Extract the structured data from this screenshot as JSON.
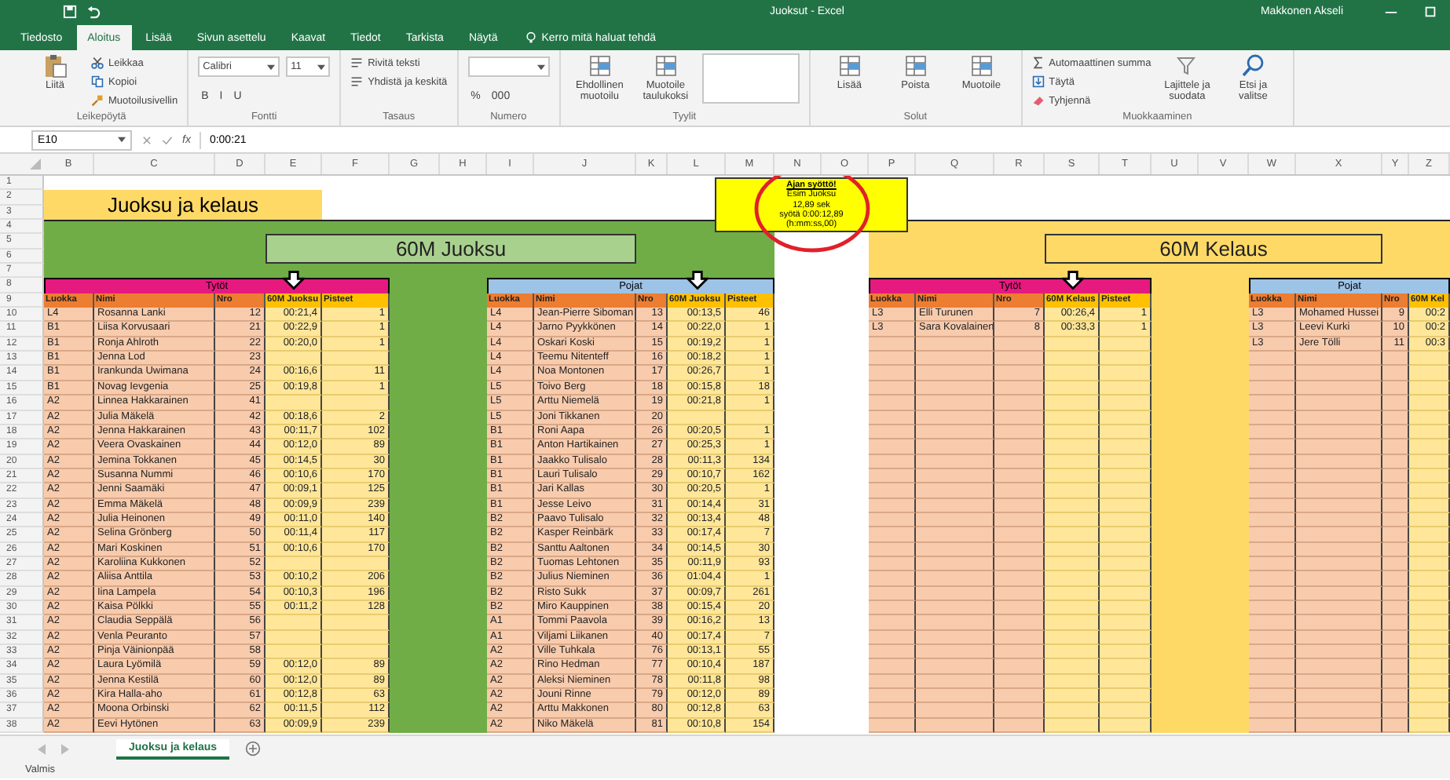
{
  "window": {
    "title": "Juoksut - Excel",
    "user": "Makkonen Akseli"
  },
  "tabs": [
    {
      "label": "Tiedosto",
      "selected": false
    },
    {
      "label": "Aloitus",
      "selected": true
    },
    {
      "label": "Lisää",
      "selected": false
    },
    {
      "label": "Sivun asettelu",
      "selected": false
    },
    {
      "label": "Kaavat",
      "selected": false
    },
    {
      "label": "Tiedot",
      "selected": false
    },
    {
      "label": "Tarkista",
      "selected": false
    },
    {
      "label": "Näytä",
      "selected": false
    }
  ],
  "tell_me": {
    "placeholder": "Kerro mitä haluat tehdä"
  },
  "ribbon": [
    {
      "label": "Leikepöytä",
      "items": [
        {
          "kind": "paste",
          "label": "Liitä"
        },
        {
          "kind": "cut",
          "label": "Leikkaa"
        },
        {
          "kind": "copy",
          "label": "Kopioi"
        },
        {
          "kind": "brush",
          "label": "Muotoilusivellin"
        }
      ]
    },
    {
      "label": "Fontti",
      "items": [
        {
          "kind": "dropdown",
          "label": "Calibri"
        },
        {
          "kind": "glyphs",
          "labels": [
            "B",
            "I",
            "U"
          ]
        },
        {
          "kind": "dropdown",
          "label": "11"
        }
      ]
    },
    {
      "label": "Tasaus",
      "items": [
        {
          "kind": "wrap",
          "label": "Rivitä teksti"
        },
        {
          "kind": "merge",
          "label": "Yhdistä ja keskitä"
        }
      ]
    },
    {
      "label": "Numero",
      "items": [
        {
          "kind": "dropdown"
        },
        {
          "kind": "glyphs",
          "labels": [
            "%",
            "000"
          ]
        }
      ]
    },
    {
      "label": "Tyylit",
      "items": [
        {
          "kind": "table",
          "label": "Ehdollinen muotoilu"
        },
        {
          "kind": "table",
          "label": "Muotoile taulukoksi"
        },
        {
          "kind": "gallery"
        }
      ]
    },
    {
      "label": "Solut",
      "items": [
        {
          "kind": "cells",
          "label": "Lisää"
        },
        {
          "kind": "cells",
          "label": "Poista"
        },
        {
          "kind": "cells",
          "label": "Muotoile"
        }
      ]
    },
    {
      "label": "Muokkaaminen",
      "items": [
        {
          "kind": "sum",
          "label": "Automaattinen summa"
        },
        {
          "kind": "fill",
          "label": "Täytä"
        },
        {
          "kind": "clear",
          "label": "Tyhjennä"
        },
        {
          "kind": "sort",
          "label": "Lajittele ja suodata"
        },
        {
          "kind": "find",
          "label": "Etsi ja valitse"
        }
      ]
    }
  ],
  "formula_bar": {
    "name_box": "E10",
    "fx": "fx",
    "value": "0:00:21"
  },
  "column_headers": [
    "B",
    "C",
    "D",
    "E",
    "F",
    "G",
    "H",
    "I",
    "J",
    "K",
    "L",
    "M",
    "N",
    "O",
    "P",
    "Q",
    "R",
    "S",
    "T",
    "U",
    "V",
    "W",
    "X",
    "Y",
    "Z"
  ],
  "row_headers": [
    "1",
    "2",
    "3",
    "4",
    "5",
    "6",
    "7",
    "8",
    "9",
    "10",
    "11",
    "12",
    "13",
    "14",
    "15",
    "16",
    "17",
    "18",
    "19",
    "20",
    "21",
    "22",
    "23",
    "24",
    "25",
    "26",
    "27",
    "28",
    "29",
    "30",
    "31",
    "32",
    "33",
    "34",
    "35",
    "36",
    "37",
    "38"
  ],
  "sheet": {
    "title": "Juoksu ja kelaus",
    "note": {
      "heading": "Ajan syöttö!",
      "lines": [
        "Esim Juoksu",
        "12,89 sek",
        "syötä 0:00:12,89",
        "(h:mm:ss,00)"
      ]
    },
    "sections": [
      {
        "title": "60M Juoksu",
        "color": "#70ad47"
      },
      {
        "title": "60M Kelaus",
        "color": "#ffd966"
      }
    ],
    "tables": [
      {
        "title": "Tytöt",
        "color": "#e6197f",
        "columns": [
          "Luokka",
          "Nimi",
          "Nro",
          "60M Juoksu",
          "Pisteet"
        ],
        "rows": [
          [
            "L4",
            "Rosanna Lanki",
            "12",
            "00:21,4",
            "1"
          ],
          [
            "B1",
            "Liisa Korvusaari",
            "21",
            "00:22,9",
            "1"
          ],
          [
            "B1",
            "Ronja Ahlroth",
            "22",
            "00:20,0",
            "1"
          ],
          [
            "B1",
            "Jenna Lod",
            "23"
          ],
          [
            "B1",
            "Irankunda Uwimana",
            "24",
            "00:16,6",
            "11"
          ],
          [
            "B1",
            "Novag Ievgenia",
            "25",
            "00:19,8",
            "1"
          ],
          [
            "A2",
            "Linnea Hakkarainen",
            "41"
          ],
          [
            "A2",
            "Julia Mäkelä",
            "42",
            "00:18,6",
            "2"
          ],
          [
            "A2",
            "Jenna Hakkarainen",
            "43",
            "00:11,7",
            "102"
          ],
          [
            "A2",
            "Veera Ovaskainen",
            "44",
            "00:12,0",
            "89"
          ],
          [
            "A2",
            "Jemina Tokkanen",
            "45",
            "00:14,5",
            "30"
          ],
          [
            "A2",
            "Susanna Nummi",
            "46",
            "00:10,6",
            "170"
          ],
          [
            "A2",
            "Jenni Saamäki",
            "47",
            "00:09,1",
            "125"
          ],
          [
            "A2",
            "Emma Mäkelä",
            "48",
            "00:09,9",
            "239"
          ],
          [
            "A2",
            "Julia Heinonen",
            "49",
            "00:11,0",
            "140"
          ],
          [
            "A2",
            "Selina Grönberg",
            "50",
            "00:11,4",
            "117"
          ],
          [
            "A2",
            "Mari Koskinen",
            "51",
            "00:10,6",
            "170"
          ],
          [
            "A2",
            "Karoliina Kukkonen",
            "52"
          ],
          [
            "A2",
            "Aliisa Anttila",
            "53",
            "00:10,2",
            "206"
          ],
          [
            "A2",
            "Iina Lampela",
            "54",
            "00:10,3",
            "196"
          ],
          [
            "A2",
            "Kaisa Pölkki",
            "55",
            "00:11,2",
            "128"
          ],
          [
            "A2",
            "Claudia Seppälä",
            "56"
          ],
          [
            "A2",
            "Venla Peuranto",
            "57"
          ],
          [
            "A2",
            "Pinja Väinionpää",
            "58"
          ],
          [
            "A2",
            "Laura Lyömilä",
            "59",
            "00:12,0",
            "89"
          ],
          [
            "A2",
            "Jenna Kestilä",
            "60",
            "00:12,0",
            "89"
          ],
          [
            "A2",
            "Kira Halla-aho",
            "61",
            "00:12,8",
            "63"
          ],
          [
            "A2",
            "Moona Orbinski",
            "62",
            "00:11,5",
            "112"
          ],
          [
            "A2",
            "Eevi Hytönen",
            "63",
            "00:09,9",
            "239"
          ]
        ]
      },
      {
        "title": "Pojat",
        "color": "#9dc3e6",
        "columns": [
          "Luokka",
          "Nimi",
          "Nro",
          "60M Juoksu",
          "Pisteet"
        ],
        "rows": [
          [
            "L4",
            "Jean-Pierre Siboman",
            "13",
            "00:13,5",
            "46"
          ],
          [
            "L4",
            "Jarno Pyykkönen",
            "14",
            "00:22,0",
            "1"
          ],
          [
            "L4",
            "Oskari Koski",
            "15",
            "00:19,2",
            "1"
          ],
          [
            "L4",
            "Teemu Nitenteff",
            "16",
            "00:18,2",
            "1"
          ],
          [
            "L4",
            "Noa Montonen",
            "17",
            "00:26,7",
            "1"
          ],
          [
            "L5",
            "Toivo Berg",
            "18",
            "00:15,8",
            "18"
          ],
          [
            "L5",
            "Arttu Niemelä",
            "19",
            "00:21,8",
            "1"
          ],
          [
            "L5",
            "Joni Tikkanen",
            "20"
          ],
          [
            "B1",
            "Roni Aapa",
            "26",
            "00:20,5",
            "1"
          ],
          [
            "B1",
            "Anton Hartikainen",
            "27",
            "00:25,3",
            "1"
          ],
          [
            "B1",
            "Jaakko Tulisalo",
            "28",
            "00:11,3",
            "134"
          ],
          [
            "B1",
            "Lauri Tulisalo",
            "29",
            "00:10,7",
            "162"
          ],
          [
            "B1",
            "Jari Kallas",
            "30",
            "00:20,5",
            "1"
          ],
          [
            "B1",
            "Jesse Leivo",
            "31",
            "00:14,4",
            "31"
          ],
          [
            "B2",
            "Paavo Tulisalo",
            "32",
            "00:13,4",
            "48"
          ],
          [
            "B2",
            "Kasper Reinbärk",
            "33",
            "00:17,4",
            "7"
          ],
          [
            "B2",
            "Santtu Aaltonen",
            "34",
            "00:14,5",
            "30"
          ],
          [
            "B2",
            "Tuomas Lehtonen",
            "35",
            "00:11,9",
            "93"
          ],
          [
            "B2",
            "Julius Nieminen",
            "36",
            "01:04,4",
            "1"
          ],
          [
            "B2",
            "Risto Sukk",
            "37",
            "00:09,7",
            "261"
          ],
          [
            "B2",
            "Miro Kauppinen",
            "38",
            "00:15,4",
            "20"
          ],
          [
            "A1",
            "Tommi Paavola",
            "39",
            "00:16,2",
            "13"
          ],
          [
            "A1",
            "Viljami Liikanen",
            "40",
            "00:17,4",
            "7"
          ],
          [
            "A2",
            "Ville Tuhkala",
            "76",
            "00:13,1",
            "55"
          ],
          [
            "A2",
            "Rino Hedman",
            "77",
            "00:10,4",
            "187"
          ],
          [
            "A2",
            "Aleksi Nieminen",
            "78",
            "00:11,8",
            "98"
          ],
          [
            "A2",
            "Jouni Rinne",
            "79",
            "00:12,0",
            "89"
          ],
          [
            "A2",
            "Arttu Makkonen",
            "80",
            "00:12,8",
            "63"
          ],
          [
            "A2",
            "Niko Mäkelä",
            "81",
            "00:10,8",
            "154"
          ]
        ]
      },
      {
        "title": "Tytöt",
        "color": "#e6197f",
        "columns": [
          "Luokka",
          "Nimi",
          "Nro",
          "60M Kelaus",
          "Pisteet"
        ],
        "rows": [
          [
            "L3",
            "Elli Turunen",
            "7",
            "00:26,4",
            "1"
          ],
          [
            "L3",
            "Sara Kovalainen",
            "8",
            "00:33,3",
            "1"
          ]
        ]
      },
      {
        "title": "Pojat",
        "color": "#9dc3e6",
        "columns": [
          "Luokka",
          "Nimi",
          "Nro",
          "60M Kel"
        ],
        "rows": [
          [
            "L3",
            "Mohamed Hussei",
            "9",
            "00:2"
          ],
          [
            "L3",
            "Leevi Kurki",
            "10",
            "00:2"
          ],
          [
            "L3",
            "Jere Tölli",
            "11",
            "00:3"
          ]
        ]
      }
    ]
  },
  "sheet_tabs": [
    {
      "label": "Juoksu ja kelaus",
      "selected": true
    }
  ],
  "status_bar": {
    "text": "Valmis"
  }
}
